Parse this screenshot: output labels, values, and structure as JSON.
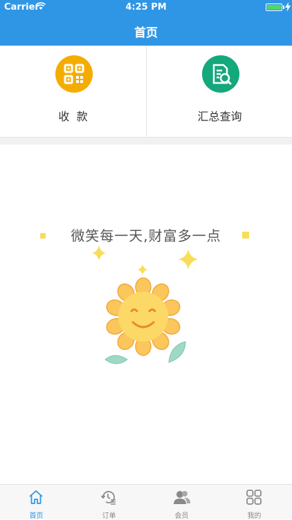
{
  "status_bar": {
    "carrier": "Carrier",
    "time": "4:25 PM",
    "battery_level": 1.0
  },
  "nav": {
    "title": "首页"
  },
  "actions": [
    {
      "label": "收  款",
      "icon": "qr-code-icon",
      "color": "#f5ac00"
    },
    {
      "label": "汇总查询",
      "icon": "document-search-icon",
      "color": "#14a87c"
    }
  ],
  "banner": {
    "slogan": "微笑每一天,财富多一点",
    "illustration": "smiling-sunflower"
  },
  "tabs": [
    {
      "label": "首页",
      "icon": "home-icon",
      "active": true
    },
    {
      "label": "订单",
      "icon": "order-history-icon",
      "active": false
    },
    {
      "label": "会员",
      "icon": "members-icon",
      "active": false
    },
    {
      "label": "我的",
      "icon": "grid-icon",
      "active": false
    }
  ],
  "colors": {
    "primary": "#2f96e6",
    "inactive": "#8a8a8a"
  }
}
